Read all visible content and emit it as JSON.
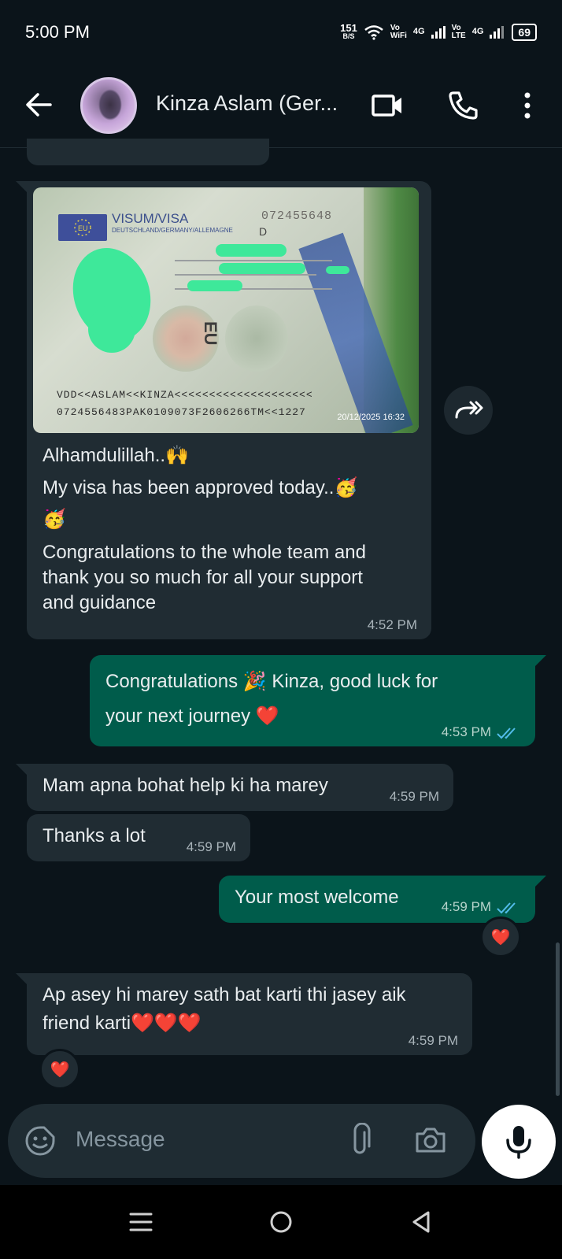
{
  "status_bar": {
    "time": "5:00 PM",
    "net_speed_value": "151",
    "net_speed_unit": "B/S",
    "vowifi_top": "Vo",
    "vowifi_bottom": "WiFi",
    "sim1_type": "4G",
    "volte_top": "Vo",
    "volte_bottom": "LTE",
    "sim2_type": "4G",
    "battery": "69"
  },
  "header": {
    "contact_name": "Kinza Aslam (Ger..."
  },
  "messages": [
    {
      "direction": "incoming",
      "image": {
        "title": "VISUM/VISA",
        "subtitle": "DEUTSCHLAND/GERMANY/ALLEMAGNE",
        "number": "072455648",
        "type_letter": "D",
        "eu_mark": "EU",
        "mrz_line1": "VDD<<ASLAM<<KINZA<<<<<<<<<<<<<<<<<<<<",
        "mrz_line2": "0724556483PAK0109073F2606266TM<<1227",
        "camera_stamp": "20/12/2025  16:32"
      },
      "lines": [
        "Alhamdulillah..🙌",
        "My visa has been approved today..🥳",
        "🥳",
        "Congratulations to the whole team and",
        "thank you so much for all your support",
        "and guidance"
      ],
      "time": "4:52 PM"
    },
    {
      "direction": "outgoing",
      "lines": [
        "Congratulations 🎉 Kinza, good luck for",
        "your next journey ❤️"
      ],
      "time": "4:53 PM",
      "status": "read"
    },
    {
      "direction": "incoming",
      "lines": [
        "Mam apna bohat help ki ha marey"
      ],
      "time": "4:59 PM"
    },
    {
      "direction": "incoming",
      "lines": [
        "Thanks a lot"
      ],
      "time": "4:59 PM"
    },
    {
      "direction": "outgoing",
      "lines": [
        "Your most welcome"
      ],
      "time": "4:59 PM",
      "status": "read",
      "reaction": "❤️"
    },
    {
      "direction": "incoming",
      "lines": [
        "Ap asey hi marey sath bat karti thi jasey aik",
        "friend karti❤️❤️❤️"
      ],
      "time": "4:59 PM",
      "reaction": "❤️"
    }
  ],
  "composer": {
    "placeholder": "Message"
  },
  "colors": {
    "background": "#0b141a",
    "incoming_bubble": "#202c33",
    "outgoing_bubble": "#005c4b",
    "read_tick": "#53bdeb"
  }
}
